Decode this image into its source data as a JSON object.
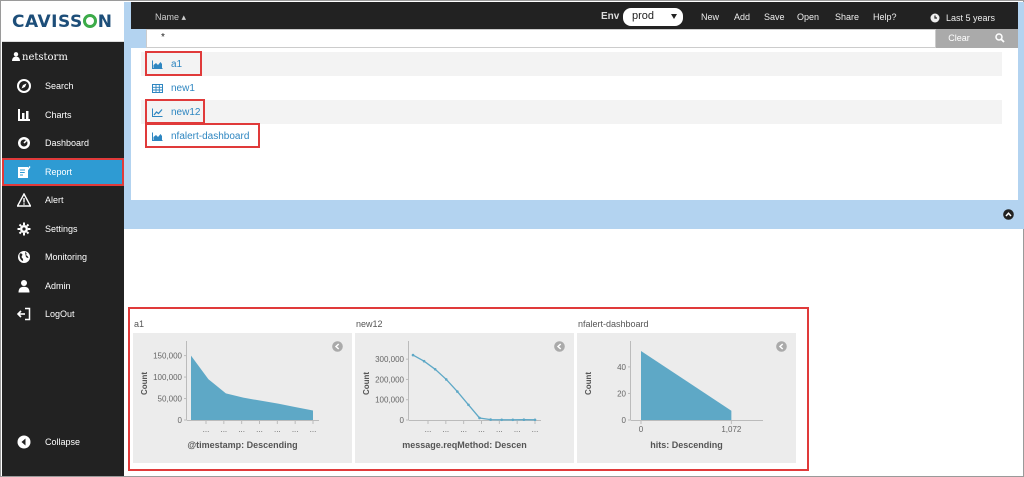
{
  "app": {
    "logo": "CAVISSON",
    "user": "netstorm"
  },
  "sidebar": {
    "items": [
      {
        "label": "Search",
        "icon": "compass-icon",
        "active": false
      },
      {
        "label": "Charts",
        "icon": "bar-chart-icon",
        "active": false
      },
      {
        "label": "Dashboard",
        "icon": "dashboard-icon",
        "active": false
      },
      {
        "label": "Report",
        "icon": "report-icon",
        "active": true
      },
      {
        "label": "Alert",
        "icon": "warning-icon",
        "active": false
      },
      {
        "label": "Settings",
        "icon": "gear-icon",
        "active": false
      },
      {
        "label": "Monitoring",
        "icon": "globe-icon",
        "active": false
      },
      {
        "label": "Admin",
        "icon": "user-icon",
        "active": false
      },
      {
        "label": "LogOut",
        "icon": "logout-icon",
        "active": false
      }
    ],
    "collapse_label": "Collapse"
  },
  "topbar": {
    "name_header": "Name",
    "env_label": "Env",
    "env_value": "prod",
    "menu": [
      "New",
      "Add",
      "Save",
      "Open",
      "Share",
      "Help?"
    ],
    "time_range": "Last 5 years"
  },
  "search": {
    "value": "*",
    "clear_label": "Clear"
  },
  "saved_objects": [
    {
      "label": "a1",
      "icon": "area-chart-icon"
    },
    {
      "label": "new1",
      "icon": "table-icon"
    },
    {
      "label": "new12",
      "icon": "line-chart-icon"
    },
    {
      "label": "nfalert-dashboard",
      "icon": "area-chart-icon"
    }
  ],
  "colors": {
    "accent": "#2e9bd3",
    "chart_fill": "#5ea8c6",
    "highlight": "#e03a3a",
    "sidebar": "#222222"
  },
  "chart_data": [
    {
      "type": "area",
      "title": "a1",
      "ylabel": "Count",
      "xlabel": "@timestamp: Descending",
      "yticks": [
        "150,000",
        "100,000",
        "50,000",
        "0"
      ],
      "ylim": [
        0,
        170000
      ],
      "x_tick_labels": [
        "...",
        "...",
        "...",
        "...",
        "...",
        "...",
        "..."
      ],
      "values": [
        150000,
        95000,
        62000,
        52000,
        45000,
        38000,
        30000,
        22000
      ]
    },
    {
      "type": "line",
      "title": "new12",
      "ylabel": "Count",
      "xlabel": "message.reqMethod: Descen",
      "yticks": [
        "300,000",
        "200,000",
        "100,000",
        "0"
      ],
      "ylim": [
        0,
        360000
      ],
      "x_tick_labels": [
        "...",
        "...",
        "...",
        "...",
        "...",
        "...",
        "..."
      ],
      "values": [
        320000,
        290000,
        250000,
        200000,
        140000,
        75000,
        10000,
        2000,
        1000,
        1000,
        1500,
        1000
      ]
    },
    {
      "type": "area",
      "title": "nfalert-dashboard",
      "ylabel": "Count",
      "xlabel": "hits: Descending",
      "yticks": [
        "40",
        "20",
        "0"
      ],
      "ylim": [
        0,
        55
      ],
      "x_tick_labels": [
        "0",
        "1,072"
      ],
      "x": [
        0,
        1072
      ],
      "values": [
        52,
        7
      ]
    }
  ]
}
